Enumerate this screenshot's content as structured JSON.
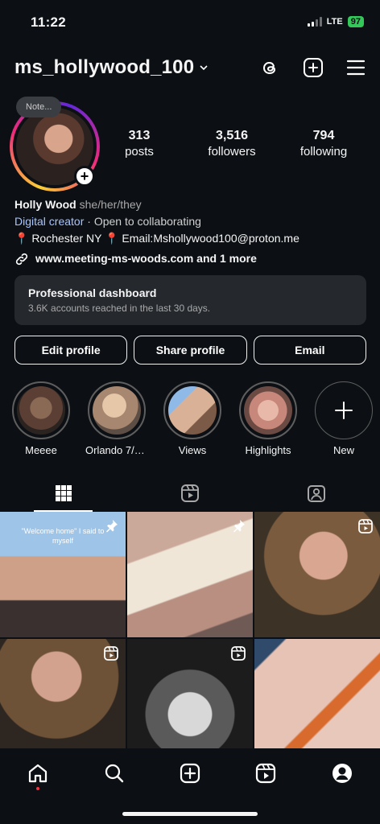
{
  "status_bar": {
    "time": "11:22",
    "network": "LTE",
    "battery": "97"
  },
  "header": {
    "username": "ms_hollywood_100"
  },
  "profile": {
    "note_label": "Note..."
  },
  "stats": [
    {
      "value": "313",
      "label": "posts"
    },
    {
      "value": "3,516",
      "label": "followers"
    },
    {
      "value": "794",
      "label": "following"
    }
  ],
  "bio": {
    "name": "Holly Wood",
    "pronouns": "she/her/they",
    "category": "Digital creator",
    "availability": "· Open to collaborating",
    "location_line": "📍 Rochester NY 📍 Email:Mshollywood100@proton.me",
    "link": "www.meeting-ms-woods.com and 1 more"
  },
  "dashboard": {
    "title": "Professional dashboard",
    "subtitle": "3.6K accounts reached in the last 30 days."
  },
  "buttons": {
    "edit": "Edit profile",
    "share": "Share profile",
    "email": "Email"
  },
  "highlights": [
    {
      "label": "Meeee"
    },
    {
      "label": "Orlando 7/2..."
    },
    {
      "label": "Views"
    },
    {
      "label": "Highlights"
    },
    {
      "label": "New"
    }
  ],
  "grid": {
    "post1_caption": "\"Welcome home\" I said to myself"
  },
  "colors": {
    "accent_link": "#a8c4ff",
    "background": "#0c1014",
    "dashboard_bg": "#25292e"
  }
}
